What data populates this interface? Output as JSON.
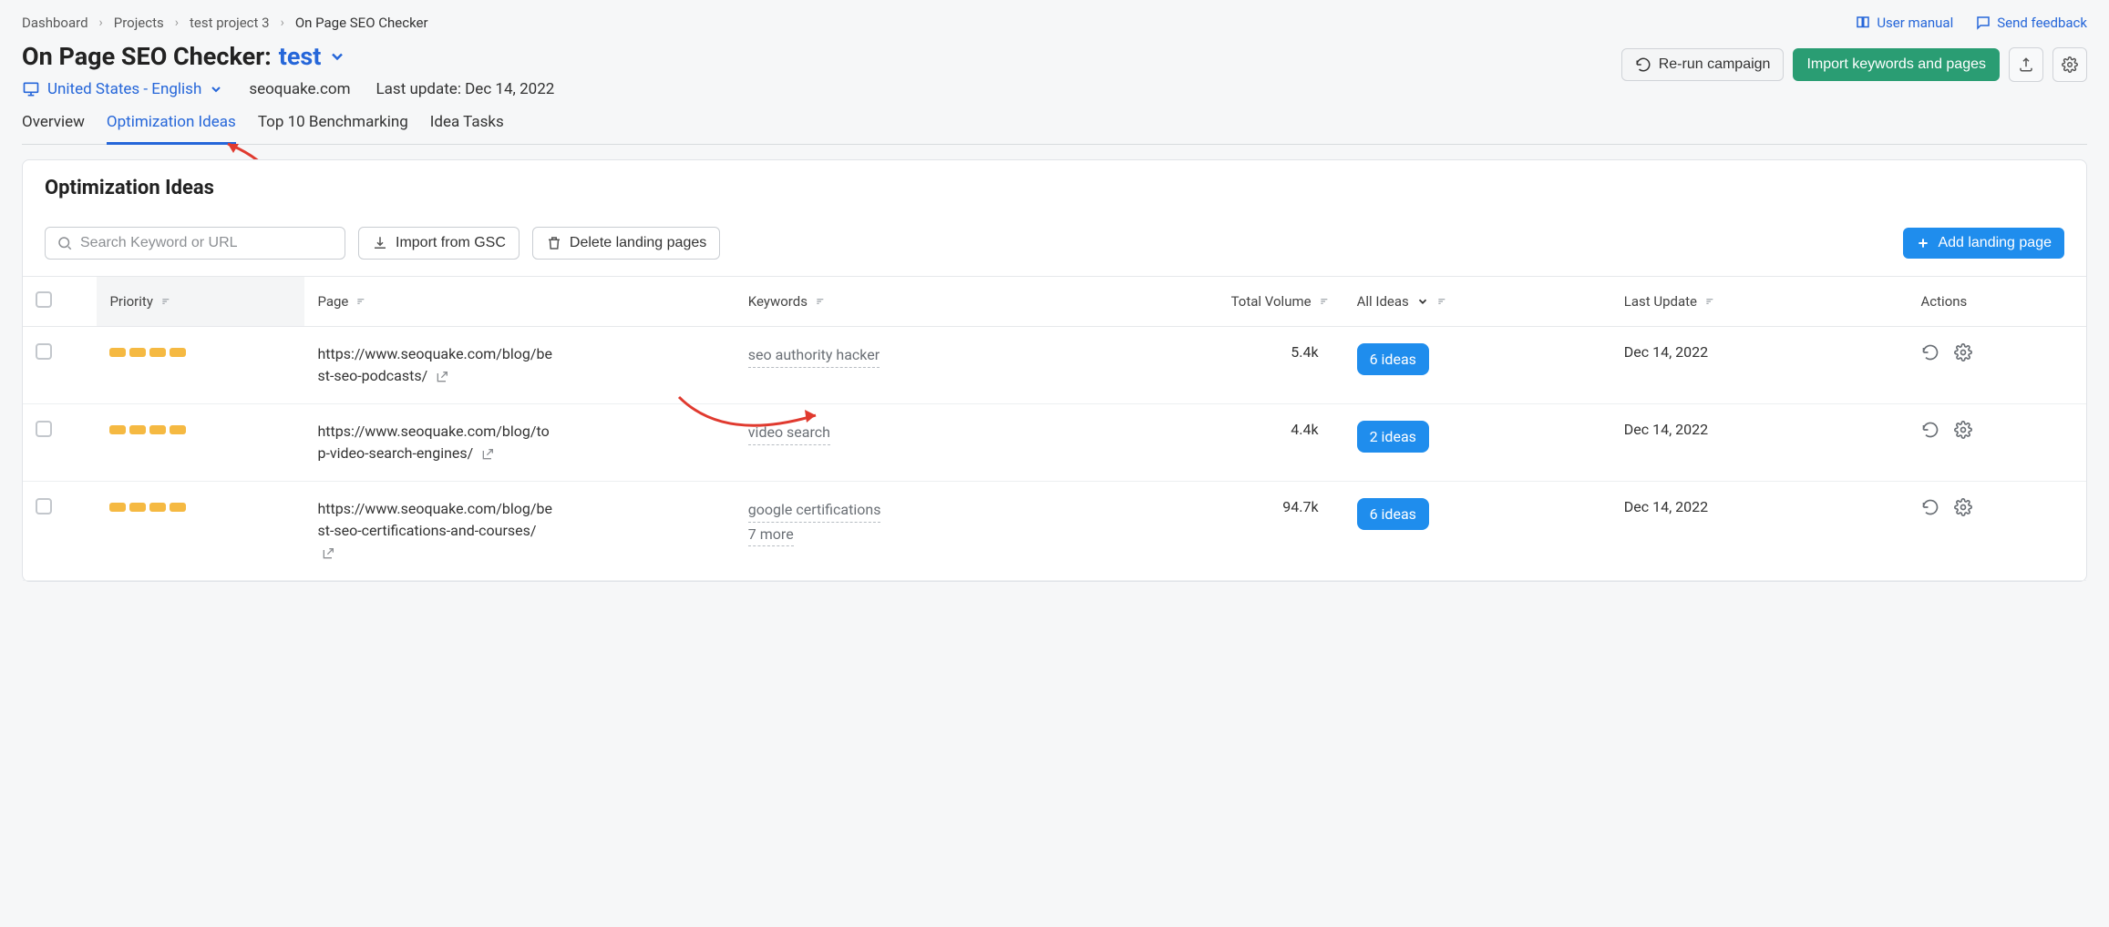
{
  "breadcrumb": {
    "items": [
      "Dashboard",
      "Projects",
      "test project 3",
      "On Page SEO Checker"
    ]
  },
  "topLinks": {
    "manual": "User manual",
    "feedback": "Send feedback"
  },
  "titlePrefix": "On Page SEO Checker:",
  "titleLink": "test",
  "locale": "United States - English",
  "domain": "seoquake.com",
  "lastUpdateLabel": "Last update: Dec 14, 2022",
  "actions": {
    "rerun": "Re-run campaign",
    "import": "Import keywords and pages"
  },
  "tabs": {
    "overview": "Overview",
    "optimization": "Optimization Ideas",
    "benchmark": "Top 10 Benchmarking",
    "tasks": "Idea Tasks"
  },
  "card": {
    "title": "Optimization Ideas",
    "searchPlaceholder": "Search Keyword or URL",
    "importGsc": "Import from GSC",
    "deletePages": "Delete landing pages",
    "addPage": "Add landing page"
  },
  "columns": {
    "priority": "Priority",
    "page": "Page",
    "keywords": "Keywords",
    "volume": "Total Volume",
    "ideas": "All Ideas",
    "update": "Last Update",
    "actions": "Actions"
  },
  "rows": [
    {
      "url": "https://www.seoquake.com/blog/best-seo-podcasts/",
      "keywords": [
        "seo authority hacker"
      ],
      "more": "",
      "volume": "5.4k",
      "ideas": "6 ideas",
      "update": "Dec 14, 2022"
    },
    {
      "url": "https://www.seoquake.com/blog/top-video-search-engines/",
      "keywords": [
        "video search"
      ],
      "more": "",
      "volume": "4.4k",
      "ideas": "2 ideas",
      "update": "Dec 14, 2022"
    },
    {
      "url": "https://www.seoquake.com/blog/best-seo-certifications-and-courses/",
      "keywords": [
        "google certifications"
      ],
      "more": "7 more",
      "volume": "94.7k",
      "ideas": "6 ideas",
      "update": "Dec 14, 2022"
    }
  ]
}
